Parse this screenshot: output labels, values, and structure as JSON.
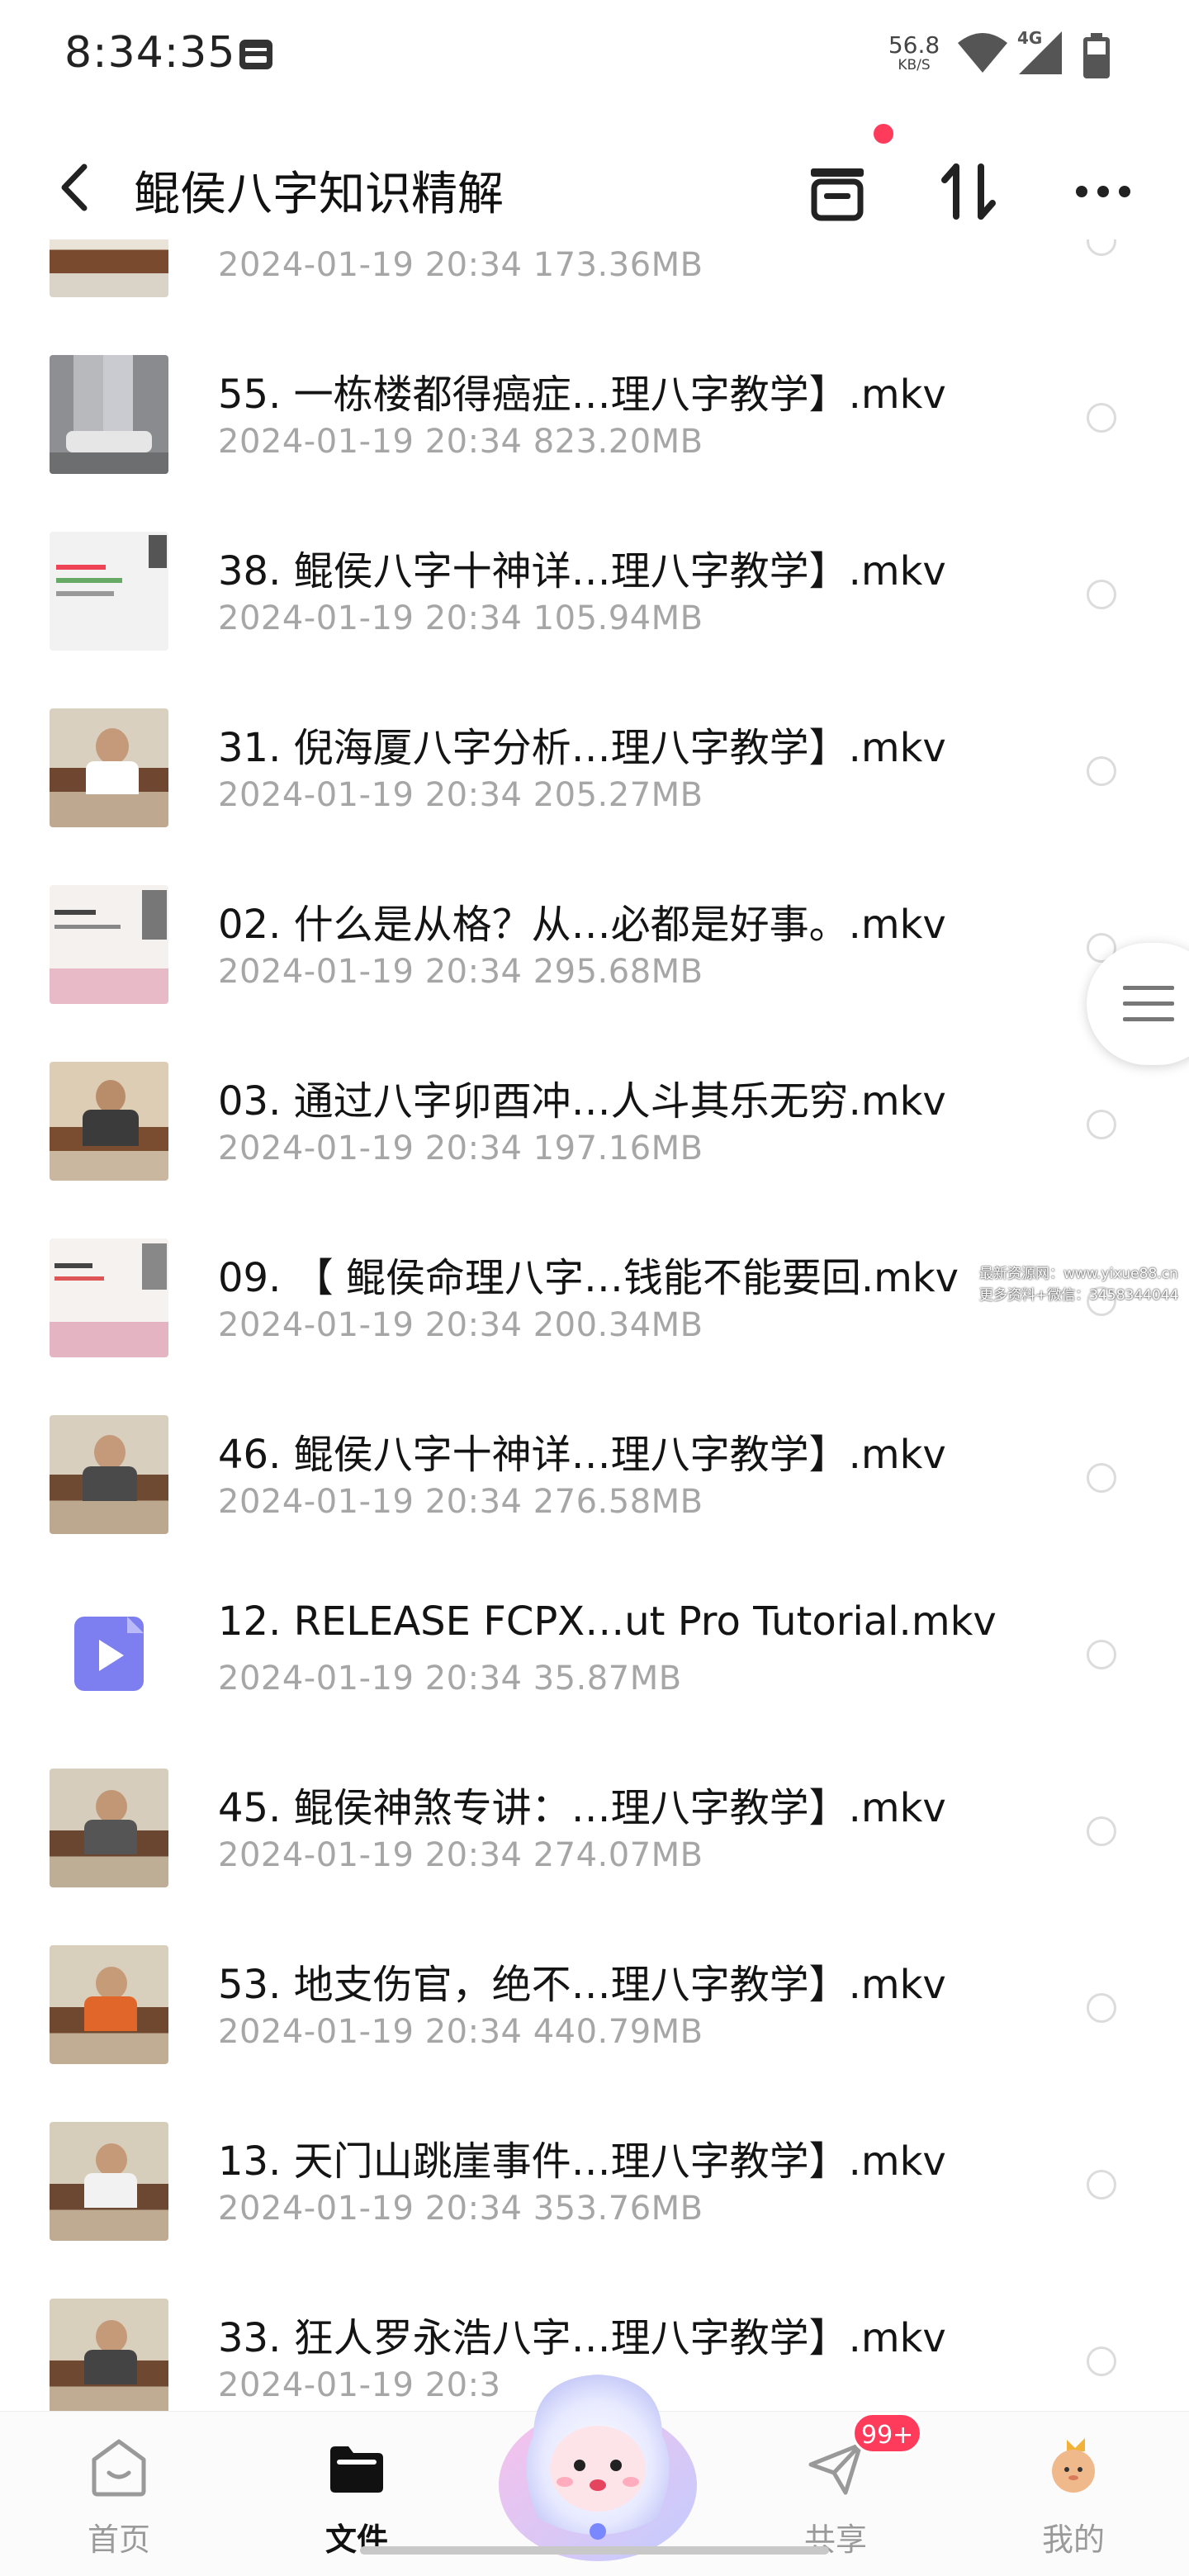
{
  "status_bar": {
    "time": "8:34:35",
    "net_speed_value": "56.8",
    "net_speed_unit": "KB/S",
    "network_type": "4G"
  },
  "header": {
    "title": "鲲侯八字知识精解",
    "back_icon": "chevron-left-icon",
    "actions": [
      "inbox-icon",
      "sort-icon",
      "more-icon"
    ],
    "notification_dot_color": "#ff3b5c"
  },
  "files": [
    {
      "name": "",
      "date": "2024-01-19",
      "time": "20:34",
      "size": "173.36MB",
      "thumb": "video"
    },
    {
      "name": "55. 一栋楼都得癌症…理八字教学】.mkv",
      "date": "2024-01-19",
      "time": "20:34",
      "size": "823.20MB",
      "thumb": "building"
    },
    {
      "name": "38. 鲲侯八字十神详…理八字教学】.mkv",
      "date": "2024-01-19",
      "time": "20:34",
      "size": "105.94MB",
      "thumb": "slide"
    },
    {
      "name": "31. 倪海厦八字分析…理八字教学】.mkv",
      "date": "2024-01-19",
      "time": "20:34",
      "size": "205.27MB",
      "thumb": "video"
    },
    {
      "name": "02. 什么是从格？从…必都是好事。.mkv",
      "date": "2024-01-19",
      "time": "20:34",
      "size": "295.68MB",
      "thumb": "slide"
    },
    {
      "name": "03. 通过八字卯酉冲…人斗其乐无穷.mkv",
      "date": "2024-01-19",
      "time": "20:34",
      "size": "197.16MB",
      "thumb": "video"
    },
    {
      "name": "09. 【 鲲侯命理八字…钱能不能要回.mkv",
      "date": "2024-01-19",
      "time": "20:34",
      "size": "200.34MB",
      "thumb": "slide"
    },
    {
      "name": "46. 鲲侯八字十神详…理八字教学】.mkv",
      "date": "2024-01-19",
      "time": "20:34",
      "size": "276.58MB",
      "thumb": "video"
    },
    {
      "name": "12. RELEASE FCPX…ut Pro Tutorial.mkv",
      "date": "2024-01-19",
      "time": "20:34",
      "size": "35.87MB",
      "thumb": "file-icon"
    },
    {
      "name": "45. 鲲侯神煞专讲：…理八字教学】.mkv",
      "date": "2024-01-19",
      "time": "20:34",
      "size": "274.07MB",
      "thumb": "video"
    },
    {
      "name": "53. 地支伤官，绝不…理八字教学】.mkv",
      "date": "2024-01-19",
      "time": "20:34",
      "size": "440.79MB",
      "thumb": "video"
    },
    {
      "name": "13. 天门山跳崖事件…理八字教学】.mkv",
      "date": "2024-01-19",
      "time": "20:34",
      "size": "353.76MB",
      "thumb": "video"
    },
    {
      "name": "33. 狂人罗永浩八字…理八字教学】.mkv",
      "date": "2024-01-19",
      "time": "20:3",
      "size": "",
      "thumb": "video"
    }
  ],
  "watermark": {
    "line1": "最新资源网：www.yixue88.cn",
    "line2": "更多资料+微信：3458344044"
  },
  "bottom_nav": [
    {
      "label": "首页",
      "icon": "home-icon",
      "active": false
    },
    {
      "label": "文件",
      "icon": "folder-icon",
      "active": true
    },
    {
      "label": "",
      "icon": "mascot-icon",
      "active": false
    },
    {
      "label": "共享",
      "icon": "send-icon",
      "active": false
    },
    {
      "label": "我的",
      "icon": "profile-avatar-icon",
      "active": false
    }
  ],
  "share_badge": "99+",
  "colors": {
    "accent": "#ff3b5c",
    "file_icon": "#6b6cf0",
    "meta_text": "#a6a6a6"
  }
}
